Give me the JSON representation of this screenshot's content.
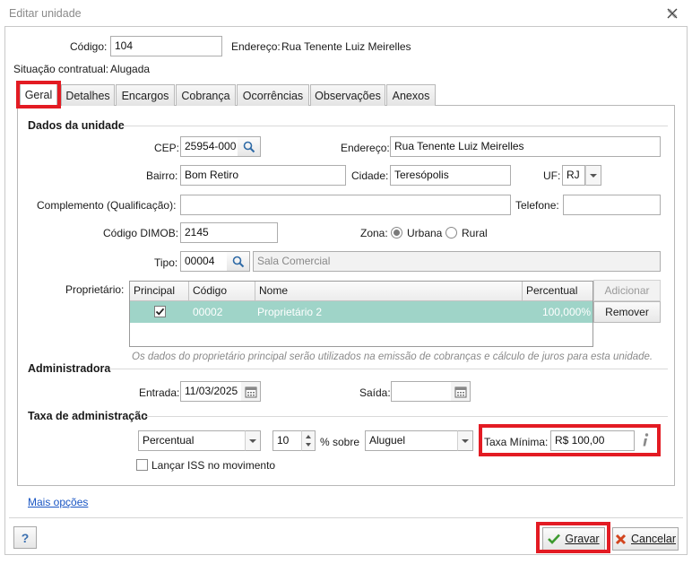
{
  "window": {
    "title": "Editar unidade"
  },
  "header": {
    "codigo_label": "Código:",
    "codigo_value": "104",
    "endereco_label": "Endereço:",
    "endereco_value": "Rua Tenente Luiz Meirelles",
    "situacao_label": "Situação contratual:",
    "situacao_value": "Alugada"
  },
  "tabs": [
    {
      "label": "Geral",
      "active": true
    },
    {
      "label": "Detalhes"
    },
    {
      "label": "Encargos"
    },
    {
      "label": "Cobrança"
    },
    {
      "label": "Ocorrências"
    },
    {
      "label": "Observações"
    },
    {
      "label": "Anexos"
    }
  ],
  "dados_unidade": {
    "title": "Dados da unidade",
    "cep_label": "CEP:",
    "cep_value": "25954-000",
    "endereco_label": "Endereço:",
    "endereco_value": "Rua Tenente Luiz Meirelles",
    "bairro_label": "Bairro:",
    "bairro_value": "Bom Retiro",
    "cidade_label": "Cidade:",
    "cidade_value": "Teresópolis",
    "uf_label": "UF:",
    "uf_value": "RJ",
    "complemento_label": "Complemento (Qualificação):",
    "complemento_value": "",
    "telefone_label": "Telefone:",
    "telefone_value": "",
    "dimob_label": "Código DIMOB:",
    "dimob_value": "2145",
    "zona_label": "Zona:",
    "zona_urbana": "Urbana",
    "zona_rural": "Rural",
    "tipo_label": "Tipo:",
    "tipo_code": "00004",
    "tipo_desc": "Sala Comercial"
  },
  "proprietario": {
    "label": "Proprietário:",
    "columns": [
      "Principal",
      "Código",
      "Nome",
      "Percentual"
    ],
    "rows": [
      {
        "principal": true,
        "codigo": "00002",
        "nome": "Proprietário 2",
        "percentual": "100,000%"
      }
    ],
    "adicionar_label": "Adicionar",
    "remover_label": "Remover",
    "note": "Os dados do proprietário principal serão utilizados na emissão de cobranças e cálculo de juros para esta unidade."
  },
  "administradora": {
    "title": "Administradora",
    "entrada_label": "Entrada:",
    "entrada_value": "11/03/2025",
    "saida_label": "Saída:",
    "saida_value": ""
  },
  "taxa": {
    "title": "Taxa de administração",
    "tipo_value": "Percentual",
    "percent_value": "10",
    "sobre_label": "% sobre",
    "base_value": "Aluguel",
    "taxa_minima_label": "Taxa Mínima:",
    "taxa_minima_value": "R$ 100,00",
    "lancar_iss_label": "Lançar ISS no movimento"
  },
  "mais_opcoes": "Mais opções",
  "footer": {
    "help_label": "?",
    "gravar_label": "Gravar",
    "cancelar_label": "Cancelar"
  },
  "colors": {
    "highlight": "#e31b23",
    "selected_row": "#9fd4c8",
    "link": "#1a56c4"
  }
}
